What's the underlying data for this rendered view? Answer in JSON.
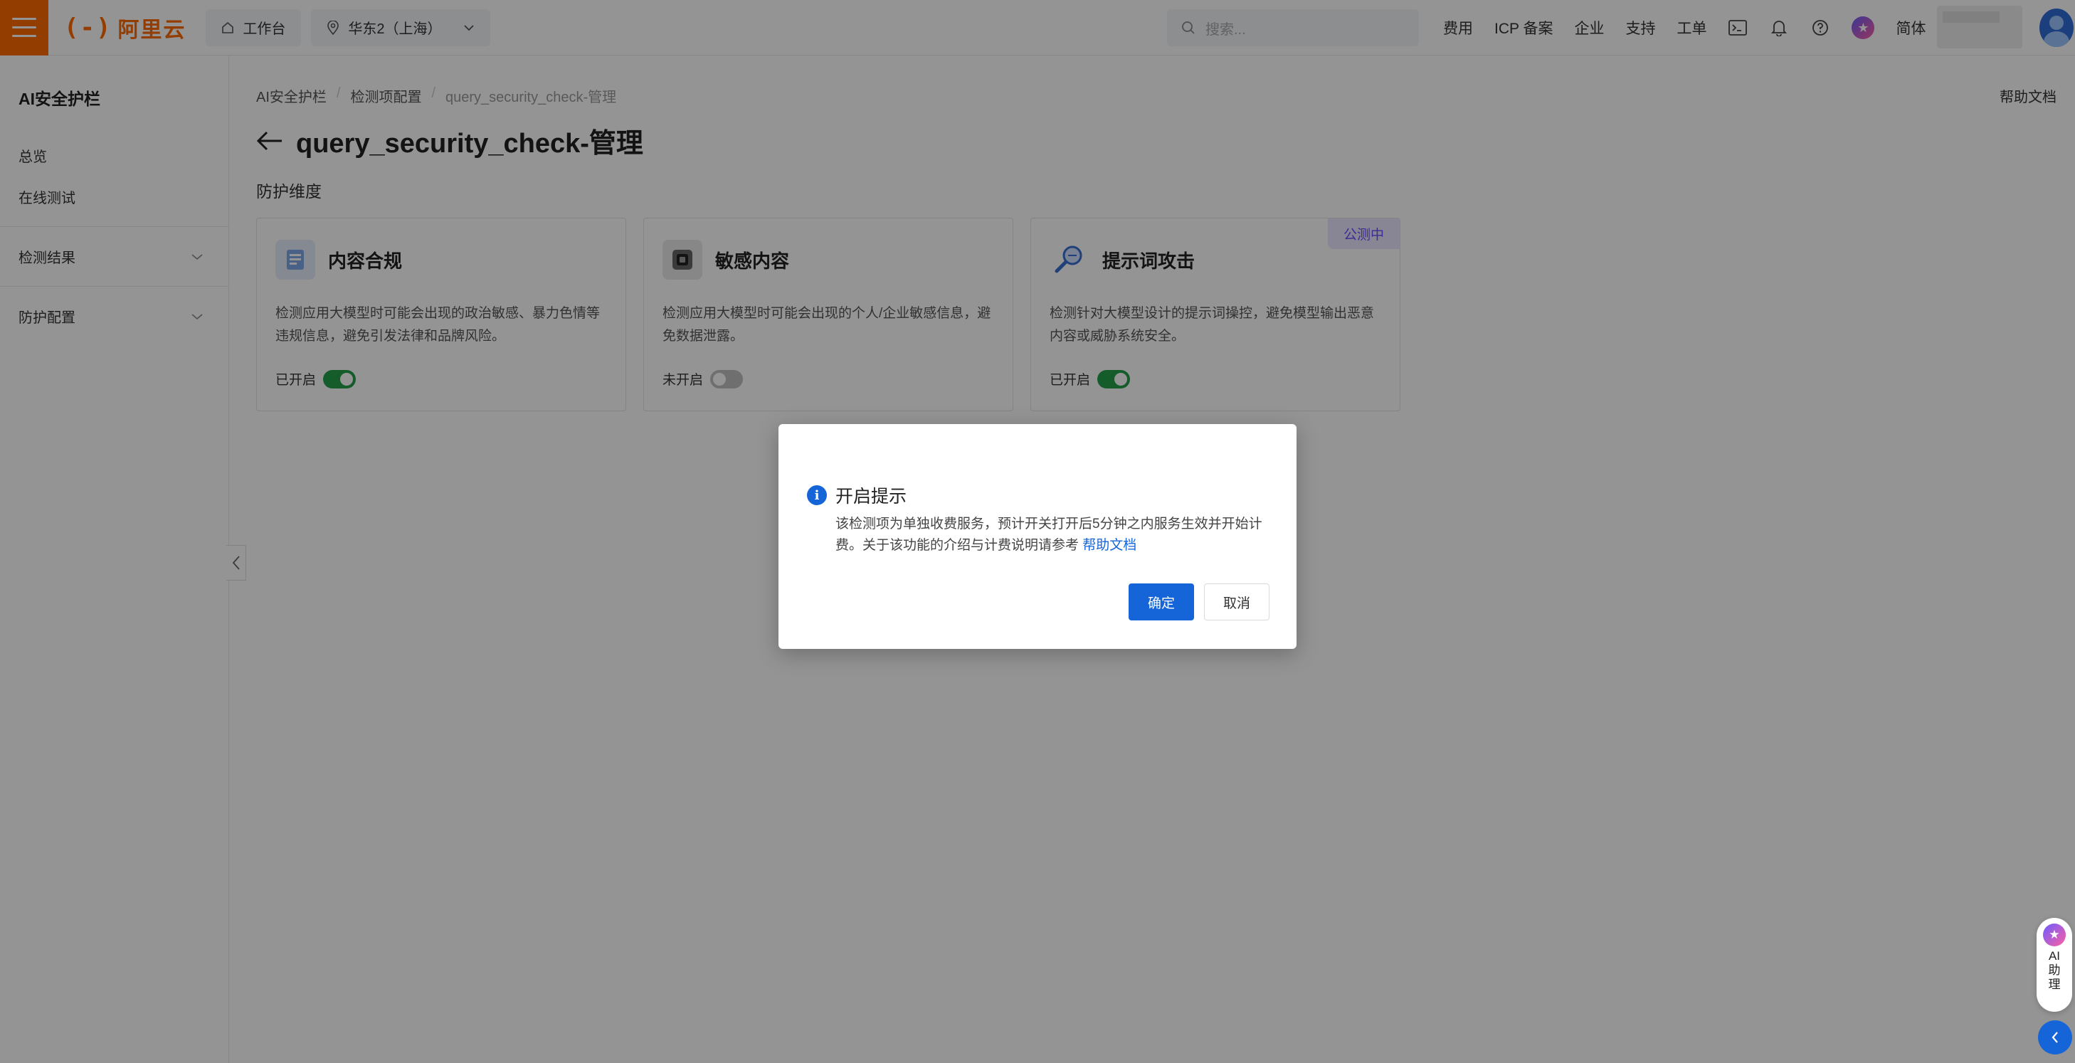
{
  "topbar": {
    "logo_text": "阿里云",
    "workbench": "工作台",
    "region": "华东2（上海）",
    "search_placeholder": "搜索...",
    "nav": [
      "费用",
      "ICP 备案",
      "企业",
      "支持",
      "工单"
    ],
    "language": "简体",
    "brand_color": "#ff6a00"
  },
  "sidebar": {
    "title": "AI安全护栏",
    "items": [
      "总览",
      "在线测试"
    ],
    "groups": [
      "检测结果",
      "防护配置"
    ]
  },
  "breadcrumb": [
    "AI安全护栏",
    "检测项配置",
    "query_security_check-管理"
  ],
  "help_doc": "帮助文档",
  "page_title": "query_security_check-管理",
  "section_title": "防护维度",
  "cards": [
    {
      "title": "内容合规",
      "desc": "检测应用大模型时可能会出现的政治敏感、暴力色情等违规信息，避免引发法律和品牌风险。",
      "status": "已开启",
      "enabled": true,
      "icon": "document-shield-icon"
    },
    {
      "title": "敏感内容",
      "desc": "检测应用大模型时可能会出现的个人/企业敏感信息，避免数据泄露。",
      "status": "未开启",
      "enabled": false,
      "icon": "lock-chip-icon"
    },
    {
      "title": "提示词攻击",
      "desc": "检测针对大模型设计的提示词操控，避免模型输出恶意内容或威胁系统安全。",
      "status": "已开启",
      "enabled": true,
      "icon": "magnifier-icon",
      "badge": "公测中"
    }
  ],
  "modal": {
    "title": "开启提示",
    "body": "该检测项为单独收费服务，预计开关打开后5分钟之内服务生效并开始计费。关于该功能的介绍与计费说明请参考",
    "link": "帮助文档",
    "confirm": "确定",
    "cancel": "取消"
  },
  "ai_helper": "AI助理",
  "colors": {
    "primary": "#1565d8",
    "toggle_on": "#23a04b",
    "badge_bg": "#ebe6ff",
    "badge_text": "#6a4bff"
  }
}
